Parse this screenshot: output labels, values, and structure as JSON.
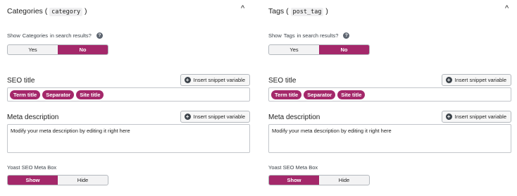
{
  "panels": [
    {
      "title": "Categories",
      "taxonomy": "category",
      "question_prefix": "Show",
      "question_name": "Categories",
      "question_suffix": "in search results?",
      "search_toggle": {
        "yes": "Yes",
        "no": "No",
        "selected": "No"
      },
      "seo_title_label": "SEO title",
      "insert_snippet_label": "Insert snippet variable",
      "seo_title_tags": [
        "Term title",
        "Separator",
        "Site title"
      ],
      "meta_description_label": "Meta description",
      "meta_description_value": "Modify your meta description by editing it right here",
      "meta_box_label": "Yoast SEO Meta Box",
      "meta_box_toggle": {
        "show": "Show",
        "hide": "Hide",
        "selected": "Show"
      }
    },
    {
      "title": "Tags",
      "taxonomy": "post_tag",
      "question_prefix": "Show",
      "question_name": "Tags",
      "question_suffix": "in search results?",
      "search_toggle": {
        "yes": "Yes",
        "no": "No",
        "selected": "No"
      },
      "seo_title_label": "SEO title",
      "insert_snippet_label": "Insert snippet variable",
      "seo_title_tags": [
        "Term title",
        "Separator",
        "Site title"
      ],
      "meta_description_label": "Meta description",
      "meta_description_value": "Modify your meta description by editing it right here",
      "meta_box_label": "Yoast SEO Meta Box",
      "meta_box_toggle": {
        "show": "Show",
        "hide": "Hide",
        "selected": "Show"
      }
    }
  ],
  "icons": {
    "collapse": "chevron-up-icon",
    "help": "question-circle-icon",
    "insert": "plus-circle-icon"
  },
  "colors": {
    "accent": "#a4286a",
    "border": "#c3c6cb",
    "text": "#1e1e1e"
  }
}
